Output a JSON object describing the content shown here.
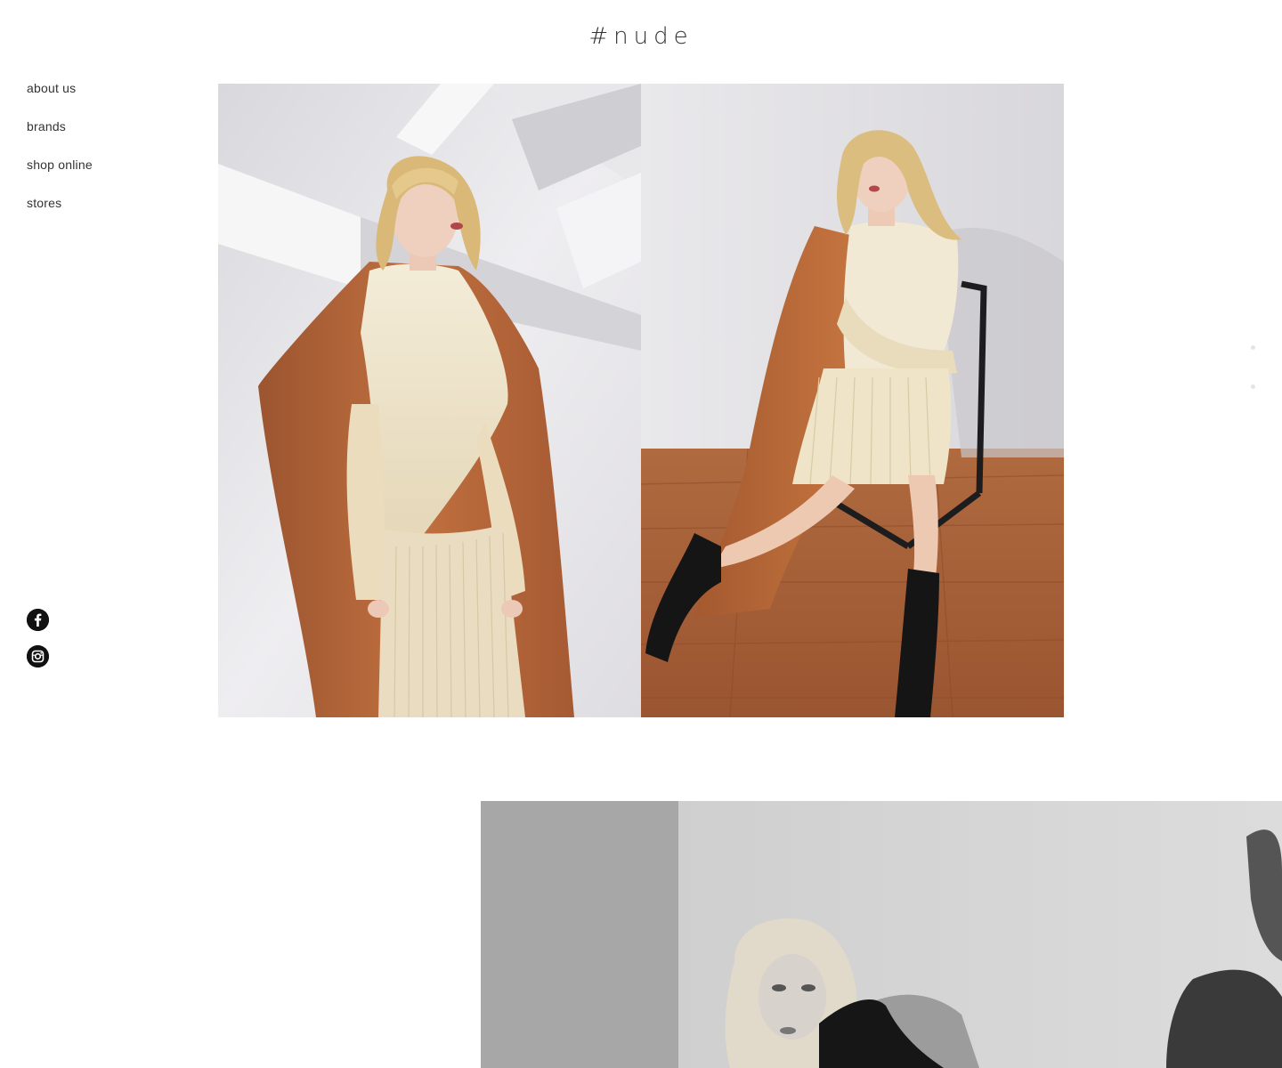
{
  "site": {
    "logo_text": "#nude"
  },
  "nav": {
    "items": [
      {
        "label": "about us"
      },
      {
        "label": "brands"
      },
      {
        "label": "shop online"
      },
      {
        "label": "stores"
      }
    ]
  },
  "social": {
    "facebook_icon": "facebook-icon",
    "instagram_icon": "instagram-icon"
  },
  "colors": {
    "background": "#ffffff",
    "text": "#333333",
    "coat": "#b8653a",
    "knit": "#efe6cf",
    "floor": "#a8613a"
  }
}
